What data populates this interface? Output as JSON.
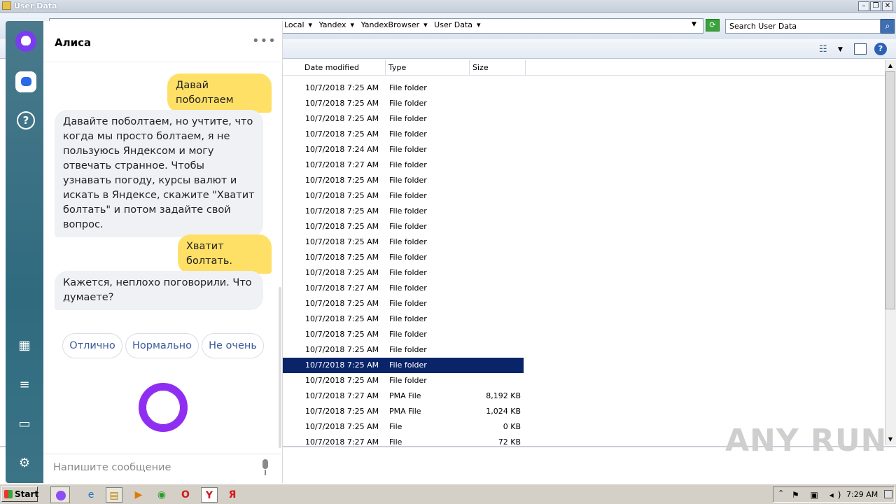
{
  "window": {
    "title": "User Data"
  },
  "address": {
    "crumbs": [
      "Local",
      "Yandex",
      "YandexBrowser",
      "User Data"
    ]
  },
  "search": {
    "placeholder": "Search User Data"
  },
  "columns": {
    "date": "Date modified",
    "type": "Type",
    "size": "Size"
  },
  "rows": [
    {
      "date": "10/7/2018 7:25 AM",
      "type": "File folder",
      "size": ""
    },
    {
      "date": "10/7/2018 7:25 AM",
      "type": "File folder",
      "size": ""
    },
    {
      "date": "10/7/2018 7:25 AM",
      "type": "File folder",
      "size": ""
    },
    {
      "date": "10/7/2018 7:25 AM",
      "type": "File folder",
      "size": ""
    },
    {
      "date": "10/7/2018 7:24 AM",
      "type": "File folder",
      "size": ""
    },
    {
      "date": "10/7/2018 7:27 AM",
      "type": "File folder",
      "size": ""
    },
    {
      "date": "10/7/2018 7:25 AM",
      "type": "File folder",
      "size": ""
    },
    {
      "date": "10/7/2018 7:25 AM",
      "type": "File folder",
      "size": ""
    },
    {
      "date": "10/7/2018 7:25 AM",
      "type": "File folder",
      "size": ""
    },
    {
      "date": "10/7/2018 7:25 AM",
      "type": "File folder",
      "size": ""
    },
    {
      "date": "10/7/2018 7:25 AM",
      "type": "File folder",
      "size": ""
    },
    {
      "date": "10/7/2018 7:25 AM",
      "type": "File folder",
      "size": ""
    },
    {
      "date": "10/7/2018 7:25 AM",
      "type": "File folder",
      "size": ""
    },
    {
      "date": "10/7/2018 7:27 AM",
      "type": "File folder",
      "size": ""
    },
    {
      "date": "10/7/2018 7:25 AM",
      "type": "File folder",
      "size": ""
    },
    {
      "date": "10/7/2018 7:25 AM",
      "type": "File folder",
      "size": ""
    },
    {
      "date": "10/7/2018 7:25 AM",
      "type": "File folder",
      "size": ""
    },
    {
      "date": "10/7/2018 7:25 AM",
      "type": "File folder",
      "size": ""
    },
    {
      "date": "10/7/2018 7:25 AM",
      "type": "File folder",
      "size": "",
      "selected": true
    },
    {
      "date": "10/7/2018 7:25 AM",
      "type": "File folder",
      "size": ""
    },
    {
      "date": "10/7/2018 7:27 AM",
      "type": "PMA File",
      "size": "8,192 KB"
    },
    {
      "date": "10/7/2018 7:25 AM",
      "type": "PMA File",
      "size": "1,024 KB"
    },
    {
      "date": "10/7/2018 7:25 AM",
      "type": "File",
      "size": "0 KB"
    },
    {
      "date": "10/7/2018 7:27 AM",
      "type": "File",
      "size": "72 KB"
    }
  ],
  "alice": {
    "title": "Алиса",
    "messages": [
      {
        "from": "user",
        "text": "Давай поболтаем"
      },
      {
        "from": "alice",
        "text": "Давайте поболтаем, но учтите, что когда мы просто болтаем, я не пользуюсь Яндексом и могу отвечать странное. Чтобы узнавать погоду, курсы валют и искать в Яндексе, скажите \"Хватит болтать\" и потом задайте свой вопрос."
      },
      {
        "from": "user",
        "text": "Хватит болтать."
      },
      {
        "from": "alice",
        "text": "Кажется, неплохо поговорили. Что думаете?"
      }
    ],
    "suggestions": [
      "Отлично",
      "Нормально",
      "Не очень"
    ],
    "input_placeholder": "Напишите сообщение"
  },
  "taskbar": {
    "start": "Start",
    "clock": "7:29 AM"
  },
  "watermark": "ANY RUN",
  "colors": {
    "alice_purple": "#8f2df2",
    "user_bubble": "#ffe066",
    "selection": "#0a246a"
  }
}
